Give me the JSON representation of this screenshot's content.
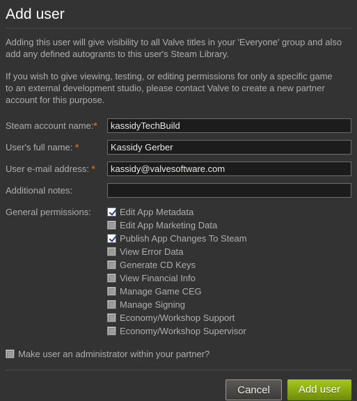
{
  "dialog": {
    "title": "Add user",
    "intro": [
      "Adding this user will give visibility to all Valve titles in your 'Everyone' group and also add any defined autogrants to this user's Steam Library.",
      "If you wish to give viewing, testing, or editing permissions for only a specific game to an external development studio, please contact Valve to create a new partner account for this purpose."
    ]
  },
  "form": {
    "fields": [
      {
        "label": "Steam account name:",
        "required": true,
        "required_mark": "*",
        "value": "kassidyTechBuild",
        "placeholder": ""
      },
      {
        "label": "User's full name: ",
        "required": true,
        "required_mark": "*",
        "value": "Kassidy Gerber",
        "placeholder": ""
      },
      {
        "label": "User e-mail address: ",
        "required": true,
        "required_mark": "*",
        "value": "kassidy@valvesoftware.com",
        "placeholder": ""
      },
      {
        "label": "Additional notes:",
        "required": false,
        "required_mark": "",
        "value": "",
        "placeholder": ""
      }
    ],
    "permissions_label": "General permissions:",
    "permissions": [
      {
        "label": "Edit App Metadata",
        "checked": true
      },
      {
        "label": "Edit App Marketing Data",
        "checked": false
      },
      {
        "label": "Publish App Changes To Steam",
        "checked": true
      },
      {
        "label": "View Error Data",
        "checked": false
      },
      {
        "label": "Generate CD Keys",
        "checked": false
      },
      {
        "label": "View Financial Info",
        "checked": false
      },
      {
        "label": "Manage Game CEG",
        "checked": false
      },
      {
        "label": "Manage Signing",
        "checked": false
      },
      {
        "label": "Economy/Workshop Support",
        "checked": false
      },
      {
        "label": "Economy/Workshop Supervisor",
        "checked": false
      }
    ],
    "admin": {
      "label": "Make user an administrator within your partner?",
      "checked": false
    }
  },
  "footer": {
    "cancel_label": "Cancel",
    "submit_label": "Add user"
  },
  "colors": {
    "background": "#333333",
    "text": "#b0aeac",
    "title": "#ffffff",
    "required_asterisk": "#c96a17",
    "input_background": "#1c1c1c",
    "input_border": "#6f6d6b",
    "divider": "#4a4846",
    "primary_button_top": "#a7c91a",
    "primary_button_bottom": "#6e8b0a",
    "checkmark": "#1d3f9e"
  }
}
